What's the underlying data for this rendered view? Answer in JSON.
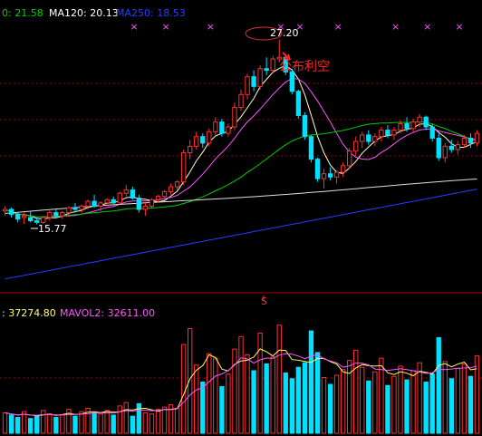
{
  "chart_data": [
    {
      "type": "candlestick",
      "panel": "price",
      "indicators": [
        {
          "label": "0: 21.58",
          "color": "#00cc00"
        },
        {
          "label": "MA120: 20.13",
          "color": "#ffffff"
        },
        {
          "label": "MA250: 18.53",
          "color": "#2040ff"
        }
      ],
      "high_label": "27.20",
      "low_label": "15.77",
      "annotation": "公布利空",
      "ohlc": [
        [
          16.6,
          16.9,
          16.3,
          16.7
        ],
        [
          16.7,
          16.8,
          16.2,
          16.4
        ],
        [
          16.4,
          16.5,
          15.9,
          16.1
        ],
        [
          16.2,
          16.5,
          15.8,
          16.3
        ],
        [
          16.2,
          16.6,
          15.9,
          16.0
        ],
        [
          16.0,
          16.2,
          15.77,
          15.9
        ],
        [
          15.9,
          16.3,
          15.8,
          16.2
        ],
        [
          16.2,
          16.6,
          16.0,
          16.5
        ],
        [
          16.5,
          16.7,
          16.2,
          16.3
        ],
        [
          16.3,
          16.6,
          16.1,
          16.5
        ],
        [
          16.5,
          16.9,
          16.3,
          16.8
        ],
        [
          16.8,
          17.1,
          16.5,
          16.7
        ],
        [
          16.7,
          17.0,
          16.5,
          16.9
        ],
        [
          16.9,
          17.3,
          16.7,
          17.2
        ],
        [
          17.2,
          17.6,
          16.8,
          16.9
        ],
        [
          16.9,
          17.2,
          16.6,
          17.1
        ],
        [
          17.1,
          17.4,
          16.9,
          17.3
        ],
        [
          17.3,
          17.5,
          17.0,
          17.1
        ],
        [
          17.1,
          17.8,
          17.0,
          17.7
        ],
        [
          17.7,
          18.2,
          17.5,
          17.9
        ],
        [
          17.9,
          18.1,
          17.3,
          17.4
        ],
        [
          17.4,
          17.6,
          16.5,
          16.7
        ],
        [
          16.7,
          17.1,
          16.3,
          16.9
        ],
        [
          16.9,
          17.4,
          16.8,
          17.3
        ],
        [
          17.3,
          17.6,
          17.1,
          17.5
        ],
        [
          17.5,
          17.9,
          17.3,
          17.8
        ],
        [
          17.8,
          18.3,
          17.6,
          18.1
        ],
        [
          18.1,
          18.5,
          17.9,
          18.4
        ],
        [
          18.4,
          20.4,
          18.2,
          20.2
        ],
        [
          20.2,
          21.0,
          19.8,
          20.6
        ],
        [
          20.6,
          21.5,
          20.4,
          21.2
        ],
        [
          21.2,
          21.4,
          20.5,
          20.8
        ],
        [
          20.8,
          21.7,
          20.6,
          21.5
        ],
        [
          21.5,
          22.4,
          21.3,
          22.1
        ],
        [
          22.1,
          22.3,
          21.2,
          21.4
        ],
        [
          21.4,
          22.0,
          21.2,
          21.8
        ],
        [
          21.8,
          23.3,
          21.6,
          23.0
        ],
        [
          23.0,
          24.1,
          22.8,
          23.8
        ],
        [
          23.8,
          25.1,
          23.5,
          24.9
        ],
        [
          24.9,
          25.3,
          24.0,
          24.3
        ],
        [
          24.3,
          25.6,
          24.1,
          25.4
        ],
        [
          25.4,
          26.1,
          25.0,
          25.3
        ],
        [
          25.3,
          26.2,
          25.1,
          26.0
        ],
        [
          26.0,
          27.2,
          25.8,
          26.1
        ],
        [
          26.1,
          26.3,
          25.0,
          25.2
        ],
        [
          25.2,
          25.4,
          23.8,
          24.0
        ],
        [
          24.0,
          24.1,
          22.3,
          22.5
        ],
        [
          22.5,
          22.7,
          21.0,
          21.2
        ],
        [
          21.2,
          21.3,
          19.6,
          19.8
        ],
        [
          19.8,
          19.9,
          18.4,
          18.6
        ],
        [
          18.6,
          19.2,
          18.0,
          18.9
        ],
        [
          18.9,
          19.3,
          18.5,
          18.7
        ],
        [
          18.7,
          19.1,
          18.3,
          19.0
        ],
        [
          19.0,
          19.6,
          18.7,
          19.4
        ],
        [
          19.4,
          20.5,
          19.2,
          20.3
        ],
        [
          20.3,
          21.2,
          20.0,
          20.9
        ],
        [
          20.9,
          21.5,
          20.5,
          21.3
        ],
        [
          21.3,
          21.6,
          20.7,
          20.9
        ],
        [
          20.9,
          21.4,
          20.6,
          21.2
        ],
        [
          21.2,
          21.8,
          20.9,
          21.6
        ],
        [
          21.6,
          21.9,
          21.1,
          21.3
        ],
        [
          21.3,
          21.8,
          21.0,
          21.6
        ],
        [
          21.6,
          22.2,
          21.4,
          22.0
        ],
        [
          22.0,
          22.4,
          21.5,
          21.7
        ],
        [
          21.7,
          22.3,
          21.5,
          22.1
        ],
        [
          22.1,
          22.6,
          21.8,
          22.4
        ],
        [
          22.4,
          22.5,
          21.6,
          21.8
        ],
        [
          21.8,
          22.0,
          20.9,
          21.1
        ],
        [
          21.1,
          21.4,
          19.7,
          19.9
        ],
        [
          19.9,
          20.8,
          19.6,
          20.6
        ],
        [
          20.6,
          21.0,
          20.2,
          20.4
        ],
        [
          20.4,
          20.9,
          20.1,
          20.7
        ],
        [
          20.7,
          21.3,
          20.5,
          21.1
        ],
        [
          21.1,
          21.4,
          20.5,
          20.8
        ],
        [
          20.8,
          21.6,
          20.6,
          21.4
        ]
      ]
    },
    {
      "type": "bar",
      "panel": "volume",
      "indicators": [
        {
          "label": ": 37274.80",
          "color": "#ffff66"
        },
        {
          "label": "MAVOL2: 32611.00",
          "color": "#ff55ff"
        }
      ],
      "values": [
        18000,
        16000,
        14000,
        19000,
        13000,
        15000,
        20000,
        17000,
        14000,
        16000,
        21000,
        15000,
        19000,
        22000,
        18000,
        17000,
        20000,
        16000,
        24000,
        27000,
        15000,
        26000,
        18000,
        17000,
        21000,
        23000,
        25000,
        22000,
        78000,
        92000,
        60000,
        45000,
        70000,
        66000,
        41000,
        52000,
        74000,
        85000,
        69000,
        55000,
        88000,
        61000,
        67000,
        95000,
        53000,
        48000,
        58000,
        62000,
        90000,
        71000,
        49000,
        43000,
        51000,
        56000,
        64000,
        73000,
        58000,
        46000,
        54000,
        66000,
        42000,
        50000,
        59000,
        47000,
        55000,
        62000,
        45000,
        52000,
        84000,
        63000,
        48000,
        57000,
        61000,
        50000,
        68000
      ]
    }
  ]
}
